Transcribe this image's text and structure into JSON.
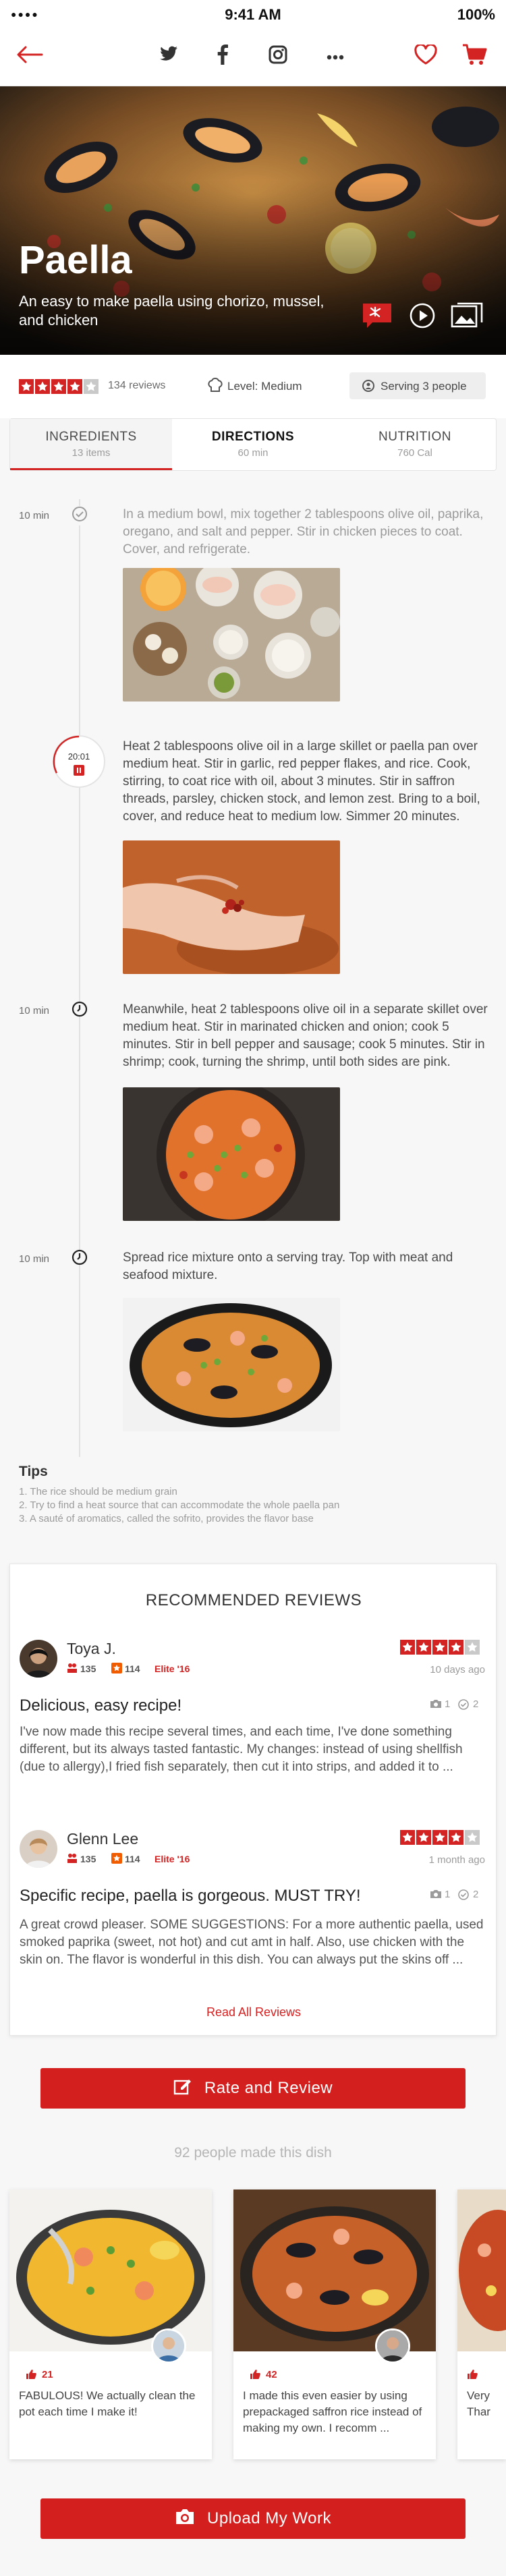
{
  "status": {
    "signal": "●●●●",
    "time": "9:41 AM",
    "battery": "100%"
  },
  "nav": {
    "icons": [
      "back-arrow-icon",
      "twitter-icon",
      "facebook-icon",
      "instagram-icon",
      "more-icon",
      "heart-icon",
      "cart-icon"
    ],
    "accent": "#d32323"
  },
  "hero": {
    "title": "Paella",
    "subtitle": "An easy to make paella using chorizo, mussel, and chicken"
  },
  "summary": {
    "rating": 4,
    "reviews": "134 reviews",
    "level": "Level: Medium",
    "serving": "Serving 3 people"
  },
  "tabs": [
    {
      "label": "INGREDIENTS",
      "sub": "13 items"
    },
    {
      "label": "DIRECTIONS",
      "sub": "60 min"
    },
    {
      "label": "NUTRITION",
      "sub": "760 Cal"
    }
  ],
  "steps": [
    {
      "time": "10 min",
      "text": "In a medium bowl, mix together 2 tablespoons olive oil, paprika, oregano, and salt and pepper. Stir in chicken pieces to coat. Cover, and refrigerate."
    },
    {
      "time": "20:01",
      "text": "Heat 2 tablespoons olive oil in a large skillet or paella pan over medium heat. Stir in garlic, red pepper flakes, and rice. Cook, stirring, to coat rice with oil, about 3 minutes. Stir in saffron threads, parsley, chicken stock, and lemon zest. Bring to a boil, cover, and reduce heat to medium low. Simmer 20 minutes."
    },
    {
      "time": "10 min",
      "text": "Meanwhile, heat 2 tablespoons olive oil in a separate skillet over medium heat. Stir in marinated chicken and onion; cook 5 minutes. Stir in bell pepper and sausage; cook 5 minutes. Stir in shrimp; cook, turning the shrimp, until both sides are pink."
    },
    {
      "time": "10 min",
      "text": "Spread rice mixture onto a serving tray. Top with meat and seafood mixture."
    }
  ],
  "tips": {
    "title": "Tips",
    "items": [
      "1. The rice should be medium grain",
      "2. Try to find a heat source that can accommodate the whole paella pan",
      "3. A sauté of aromatics, called the sofrito, provides the flavor base"
    ]
  },
  "reviews": {
    "heading": "RECOMMENDED REVIEWS",
    "read_all": "Read All Reviews",
    "items": [
      {
        "name": "Toya J.",
        "friends": "135",
        "count": "114",
        "elite": "Elite '16",
        "rating": 4,
        "date": "10 days ago",
        "photos": "",
        "checkins": "",
        "title": "Delicious, easy recipe!",
        "body": "I've now made this recipe several times, and each time, I've done something different, but its always tasted fantastic. My changes: instead of using shellfish (due to allergy),I fried fish separately, then cut it into strips, and added it to ..."
      },
      {
        "name": "Glenn Lee",
        "friends": "135",
        "count": "114",
        "elite": "Elite '16",
        "rating": 4,
        "date": "1 month ago",
        "photos": "1",
        "checkins": "2",
        "title": "Specific recipe, paella is gorgeous. MUST TRY!",
        "body": "A great crowd pleaser. SOME SUGGESTIONS: For a more authentic paella, used smoked paprika (sweet, not hot) and cut amt in half. Also, use chicken with the skin on. The flavor is wonderful in this dish. You can always put the skins off ..."
      }
    ],
    "first_meta": {
      "photos": "1",
      "checkins": "2"
    }
  },
  "rate_button": "Rate and Review",
  "made_count": "92 people made this dish",
  "made_cards": [
    {
      "likes": "21",
      "text": "FABULOUS! We actually clean the pot each time I make it!"
    },
    {
      "likes": "42",
      "text": "I made this even easier by using prepackaged saffron rice instead of making my own. I recomm ..."
    },
    {
      "likes": "",
      "text": "Very Thar"
    }
  ],
  "upload_button": "Upload My Work"
}
